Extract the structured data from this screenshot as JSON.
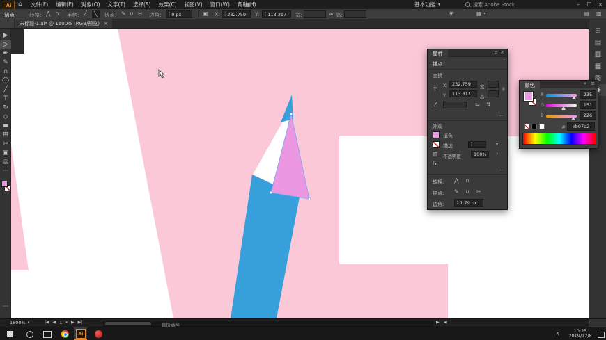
{
  "titlebar": {
    "logo": "Ai",
    "home_icon": "⌂",
    "menus": [
      "文件(F)",
      "编辑(E)",
      "对象(O)",
      "文字(T)",
      "选择(S)",
      "效果(C)",
      "视图(V)",
      "窗口(W)",
      "帮助(H)"
    ],
    "arrange_icon": "▦",
    "arrange_caret": "▾",
    "workspace": "基本功能",
    "workspace_caret": "▾",
    "search_placeholder": "搜索 Adobe Stock",
    "minimize": "–",
    "restore": "☐",
    "close": "×"
  },
  "control_bar": {
    "context": "锚点",
    "convert_label": "转换:",
    "convert_icons": [
      "⋀",
      "∩"
    ],
    "handles_label": "手柄:",
    "handle_icons": [
      "╱",
      "╲"
    ],
    "anchors_label": "锚点:",
    "anchor_icons": [
      "✎",
      "∪",
      "✂"
    ],
    "corner_label": "边角:",
    "corner_value": "0 px",
    "iso_icon": "▣",
    "x_label": "X:",
    "x_value": "232.759",
    "y_label": "Y:",
    "y_value": "113.317",
    "w_label": "宽:",
    "h_label": "高:",
    "link_icon": "∞",
    "transform_icon": "⊞",
    "align_icon": "▦",
    "align_caret": "▾"
  },
  "doc_tab": {
    "title": "未标题-1.ai* @ 1600% (RGB/预览)",
    "close": "×"
  },
  "toolbar": {
    "glyphs": [
      "▶",
      "▷",
      "✒",
      "✎",
      "∩",
      "◯",
      "╱",
      "T",
      "↻",
      "◇",
      "▬",
      "⊞",
      "✂",
      "▣",
      "◎",
      "⋯"
    ],
    "active_index": 1,
    "fill_color": "#eb97e2"
  },
  "canvas": {
    "colors": {
      "background": "#fbc8d8",
      "white": "#ffffff",
      "pasteboard": "#2b2b2b",
      "pencil_blue": "#379fd9",
      "triangle": "#eb97e2",
      "selection": "#7aa7f2"
    }
  },
  "dock": {
    "icons": [
      "⊞",
      "▤",
      "▥",
      "▦",
      "▧",
      "◉"
    ]
  },
  "properties": {
    "title": "属性",
    "header_icons": [
      "▫",
      "×"
    ],
    "scroll_hint": "▴",
    "context": "锚点",
    "transform": {
      "heading": "变换",
      "ref_icon": "╋",
      "x_label": "X:",
      "x": "232.759",
      "y_label": "Y:",
      "y": "113.317",
      "w_label": "宽:",
      "h_label": "高:",
      "link_icon": "∞",
      "angle_icon": "∠",
      "flip_h_icon": "⇋",
      "flip_v_icon": "⇅",
      "more": "..."
    },
    "appearance": {
      "heading": "外观",
      "fill_label": "填色",
      "stroke_label": "描边",
      "stroke_caret": "▾",
      "opacity_label": "不透明度",
      "opacity": "100%",
      "opacity_more": "›",
      "fx": "fx.",
      "more": "..."
    },
    "anchor": {
      "convert_label": "转换:",
      "convert_icons": [
        "⋀",
        "∩"
      ],
      "anchor_label": "锚点:",
      "anchor_icons": [
        "✎",
        "∪",
        "✂"
      ],
      "corner_label": "边角:",
      "corner_value": "1.79 px"
    }
  },
  "color_panel": {
    "title": "颜色",
    "collapse_icon": "»",
    "menu_icon": "≡",
    "channels": [
      {
        "label": "R",
        "value": "235"
      },
      {
        "label": "G",
        "value": "151"
      },
      {
        "label": "B",
        "value": "226"
      }
    ],
    "hex_prefix": "#",
    "hex": "eb97e2"
  },
  "status_bar": {
    "zoom": "1600%",
    "zoom_caret": "▾",
    "nav_first": "|◀",
    "nav_prev": "◀",
    "artboard": "1",
    "artboard_caret": "▾",
    "nav_next": "▶",
    "nav_last": "▶|",
    "tool": "直接选择",
    "scroll_right": "▶",
    "scroll_left": "◀"
  },
  "taskbar": {
    "chevron": "∧",
    "time": "10:25",
    "date": "2019/12/8"
  }
}
